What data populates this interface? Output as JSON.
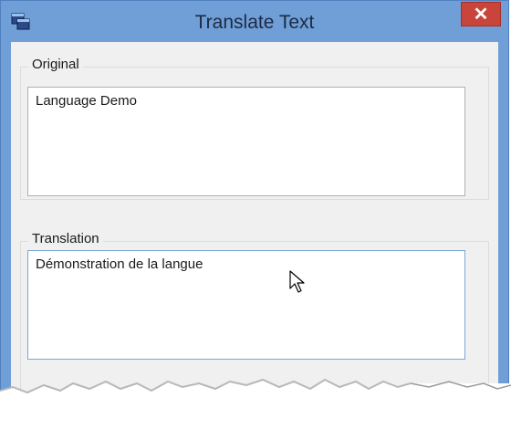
{
  "window": {
    "title": "Translate Text",
    "close_label": "✕",
    "icons": {
      "app": "copy-windows-icon",
      "close": "close-icon",
      "cursor": "mouse-pointer-icon"
    }
  },
  "original": {
    "group_label": "Original",
    "text": "Language Demo"
  },
  "translation": {
    "group_label": "Translation",
    "text": "Démonstration de la langue"
  },
  "colors": {
    "frame": "#6f9fd6",
    "close_button": "#c9453c",
    "client_background": "#f0f0f0",
    "focus_border": "#7aa7d6"
  }
}
